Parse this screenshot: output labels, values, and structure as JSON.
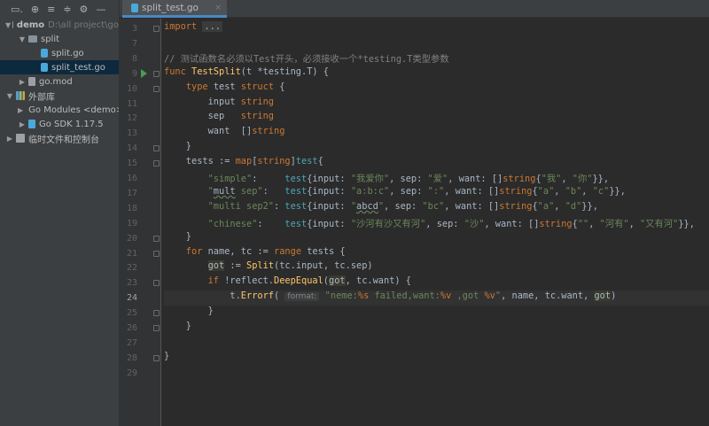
{
  "sidebar": {
    "items": [
      {
        "label": "demo",
        "path": "D:\\all project\\go",
        "icon": "folder-icon",
        "arrow": "v",
        "indent": 0,
        "bold": true
      },
      {
        "label": "split",
        "icon": "folder-icon",
        "arrow": "v",
        "indent": 1
      },
      {
        "label": "split.go",
        "icon": "go-file-icon",
        "arrow": "",
        "indent": 2
      },
      {
        "label": "split_test.go",
        "icon": "go-test-file-icon",
        "arrow": "",
        "indent": 2,
        "selected": true
      },
      {
        "label": "go.mod",
        "icon": "mod-file-icon",
        "arrow": ">",
        "indent": 1
      },
      {
        "label": "外部库",
        "icon": "library-icon",
        "arrow": "v",
        "indent": 0
      },
      {
        "label": "Go Modules <demo>",
        "icon": "library-icon",
        "arrow": ">",
        "indent": 1
      },
      {
        "label": "Go SDK 1.17.5",
        "icon": "sdk-icon",
        "arrow": ">",
        "indent": 1
      },
      {
        "label": "临时文件和控制台",
        "icon": "scratch-icon",
        "arrow": ">",
        "indent": 0
      }
    ]
  },
  "tab": {
    "label": "split_test.go",
    "close": "×"
  },
  "editor": {
    "current_line": 24,
    "lines": [
      {
        "n": "3",
        "t": [
          [
            "kw",
            "import "
          ],
          [
            "fold",
            "..."
          ]
        ]
      },
      {
        "n": "7",
        "t": []
      },
      {
        "n": "8",
        "t": [
          [
            "cm",
            "// 测试函数名必须以Test开头，必须接收一个*testing.T类型参数"
          ]
        ]
      },
      {
        "n": "9",
        "t": [
          [
            "kw",
            "func "
          ],
          [
            "fn",
            "TestSplit"
          ],
          [
            "",
            "(t *testing.T) {"
          ]
        ]
      },
      {
        "n": "10",
        "t": [
          [
            "",
            "    "
          ],
          [
            "kw",
            "type "
          ],
          [
            "",
            "test "
          ],
          [
            "kw",
            "struct"
          ],
          [
            "",
            " {"
          ]
        ]
      },
      {
        "n": "11",
        "t": [
          [
            "",
            "        input "
          ],
          [
            "kw",
            "string"
          ]
        ]
      },
      {
        "n": "12",
        "t": [
          [
            "",
            "        sep   "
          ],
          [
            "kw",
            "string"
          ]
        ]
      },
      {
        "n": "13",
        "t": [
          [
            "",
            "        want  []"
          ],
          [
            "kw",
            "string"
          ]
        ]
      },
      {
        "n": "14",
        "t": [
          [
            "",
            "    }"
          ]
        ]
      },
      {
        "n": "15",
        "t": [
          [
            "",
            "    tests := "
          ],
          [
            "kw",
            "map"
          ],
          [
            "",
            "["
          ],
          [
            "kw",
            "string"
          ],
          [
            "",
            "]"
          ],
          [
            "ty",
            "test"
          ],
          [
            "",
            "{"
          ]
        ]
      },
      {
        "n": "16",
        "t": [
          [
            "st",
            "        \"simple\""
          ],
          [
            "",
            ":     "
          ],
          [
            "ty",
            "test"
          ],
          [
            "",
            "{input: "
          ],
          [
            "st",
            "\"我爱你\""
          ],
          [
            "",
            ", sep: "
          ],
          [
            "st",
            "\"爱\""
          ],
          [
            "",
            ", want: []"
          ],
          [
            "kw",
            "string"
          ],
          [
            "",
            "{"
          ],
          [
            "st",
            "\"我\""
          ],
          [
            "",
            ", "
          ],
          [
            "st",
            "\"你\""
          ],
          [
            "",
            "}},"
          ]
        ]
      },
      {
        "n": "17",
        "t": [
          [
            "st",
            "        \""
          ],
          [
            "ul",
            "mult"
          ],
          [
            "st",
            " sep\""
          ],
          [
            "",
            ":   "
          ],
          [
            "ty",
            "test"
          ],
          [
            "",
            "{input: "
          ],
          [
            "st",
            "\"a:b:c\""
          ],
          [
            "",
            ", sep: "
          ],
          [
            "st",
            "\":\""
          ],
          [
            "",
            ", want: []"
          ],
          [
            "kw",
            "string"
          ],
          [
            "",
            "{"
          ],
          [
            "st",
            "\"a\""
          ],
          [
            "",
            ", "
          ],
          [
            "st",
            "\"b\""
          ],
          [
            "",
            ", "
          ],
          [
            "st",
            "\"c\""
          ],
          [
            "",
            "}},"
          ]
        ]
      },
      {
        "n": "18",
        "t": [
          [
            "st",
            "        \"multi sep2\""
          ],
          [
            "",
            ": "
          ],
          [
            "ty",
            "test"
          ],
          [
            "",
            "{input: "
          ],
          [
            "st",
            "\""
          ],
          [
            "ul",
            "abcd"
          ],
          [
            "st",
            "\""
          ],
          [
            "",
            ", sep: "
          ],
          [
            "st",
            "\"bc\""
          ],
          [
            "",
            ", want: []"
          ],
          [
            "kw",
            "string"
          ],
          [
            "",
            "{"
          ],
          [
            "st",
            "\"a\""
          ],
          [
            "",
            ", "
          ],
          [
            "st",
            "\"d\""
          ],
          [
            "",
            "}},"
          ]
        ]
      },
      {
        "n": "19",
        "t": [
          [
            "st",
            "        \"chinese\""
          ],
          [
            "",
            ":    "
          ],
          [
            "ty",
            "test"
          ],
          [
            "",
            "{input: "
          ],
          [
            "st",
            "\"沙河有沙又有河\""
          ],
          [
            "",
            ", sep: "
          ],
          [
            "st",
            "\"沙\""
          ],
          [
            "",
            ", want: []"
          ],
          [
            "kw",
            "string"
          ],
          [
            "",
            "{"
          ],
          [
            "st",
            "\"\""
          ],
          [
            "",
            ", "
          ],
          [
            "st",
            "\"河有\""
          ],
          [
            "",
            ", "
          ],
          [
            "st",
            "\"又有河\""
          ],
          [
            "",
            "}},"
          ]
        ]
      },
      {
        "n": "20",
        "t": [
          [
            "",
            "    }"
          ]
        ]
      },
      {
        "n": "21",
        "t": [
          [
            "kw",
            "    for "
          ],
          [
            "",
            "name, tc := "
          ],
          [
            "kw",
            "range "
          ],
          [
            "",
            "tests {"
          ]
        ]
      },
      {
        "n": "22",
        "t": [
          [
            "",
            "        "
          ],
          [
            "hl",
            "got"
          ],
          [
            "",
            " := "
          ],
          [
            "fn",
            "Split"
          ],
          [
            "",
            "(tc.input, tc.sep)"
          ]
        ]
      },
      {
        "n": "23",
        "t": [
          [
            "kw",
            "        if "
          ],
          [
            "",
            "!reflect."
          ],
          [
            "fn",
            "DeepEqual"
          ],
          [
            "",
            "("
          ],
          [
            "hl",
            "got"
          ],
          [
            "",
            ", tc.want) {"
          ]
        ]
      },
      {
        "n": "24",
        "t": [
          [
            "",
            "            t."
          ],
          [
            "fn",
            "Errorf"
          ],
          [
            "",
            "( "
          ],
          [
            "hint",
            "format:"
          ],
          [
            "st",
            " \"neme:"
          ],
          [
            "fmt",
            "%s"
          ],
          [
            "st",
            " failed,want:"
          ],
          [
            "fmt",
            "%v"
          ],
          [
            "st",
            " ,got "
          ],
          [
            "fmt",
            "%v"
          ],
          [
            "st",
            "\""
          ],
          [
            "",
            ", name, tc.want, "
          ],
          [
            "hl",
            "got"
          ],
          [
            "",
            ")"
          ]
        ]
      },
      {
        "n": "25",
        "t": [
          [
            "",
            "        }"
          ]
        ]
      },
      {
        "n": "26",
        "t": [
          [
            "",
            "    }"
          ]
        ]
      },
      {
        "n": "27",
        "t": []
      },
      {
        "n": "28",
        "t": [
          [
            "",
            "}"
          ]
        ]
      },
      {
        "n": "29",
        "t": []
      }
    ]
  }
}
